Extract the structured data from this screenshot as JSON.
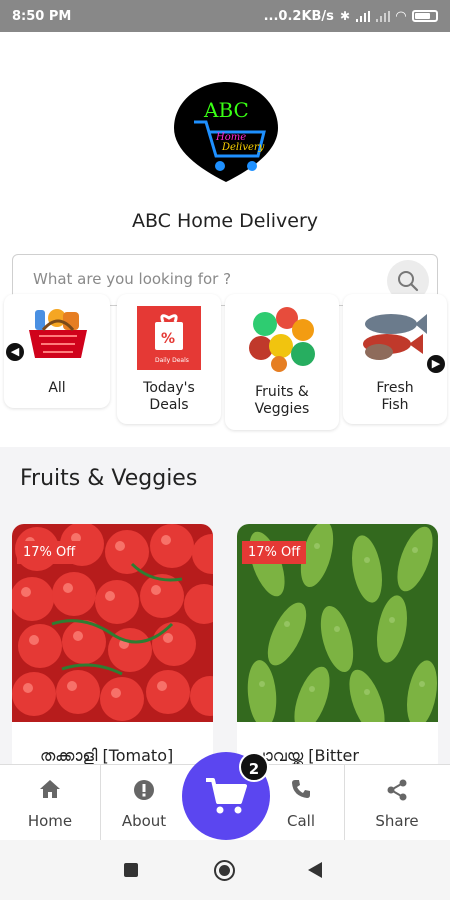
{
  "status_bar": {
    "time": "8:50 PM",
    "network_speed": "...0.2KB/s"
  },
  "app": {
    "logo_text": "ABC",
    "logo_subtext_1": "Home",
    "logo_subtext_2": "Delivery",
    "brand_name": "ABC Home Delivery"
  },
  "search": {
    "placeholder": "What are you looking for ?"
  },
  "categories": [
    {
      "label": "All"
    },
    {
      "label": "Today's\nDeals",
      "badge": "Daily Deals"
    },
    {
      "label": "Fruits &\nVeggies"
    },
    {
      "label": "Fresh\nFish"
    }
  ],
  "section": {
    "title": "Fruits & Veggies"
  },
  "products": [
    {
      "discount": "17% Off",
      "name": "തക്കാളി [Tomato]"
    },
    {
      "discount": "17% Off",
      "name": "പാവയ്ക്ക [Bitter"
    }
  ],
  "bottom_nav": {
    "home": "Home",
    "about": "About",
    "call": "Call",
    "share": "Share",
    "cart_count": "2"
  },
  "colors": {
    "accent": "#5b46f0",
    "discount": "#e53935",
    "logo_neon_green": "#39ff14",
    "logo_neon_blue": "#1e90ff",
    "logo_neon_pink": "#ff2bd6"
  }
}
